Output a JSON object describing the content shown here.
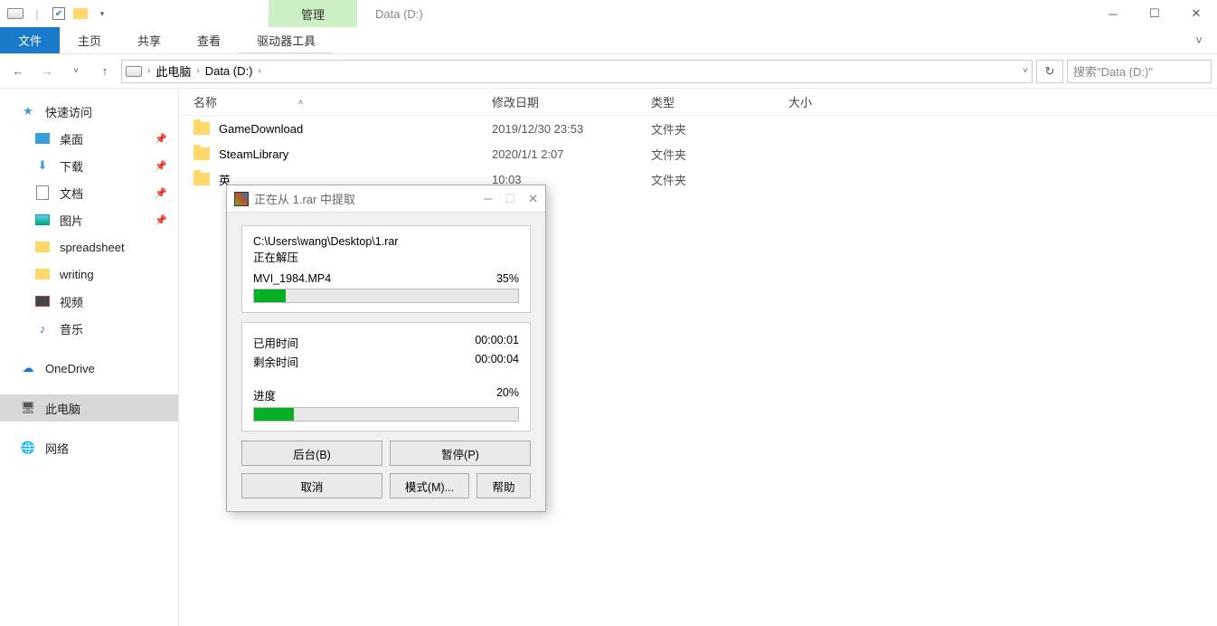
{
  "titlebar": {
    "manage_tab": "管理",
    "window_title": "Data (D:)"
  },
  "ribbon": {
    "file": "文件",
    "home": "主页",
    "share": "共享",
    "view": "查看",
    "drive_tools": "驱动器工具"
  },
  "breadcrumb": {
    "root": "此电脑",
    "current": "Data (D:)"
  },
  "search": {
    "placeholder": "搜索\"Data (D:)\""
  },
  "sidebar": {
    "quick": "快速访问",
    "desktop": "桌面",
    "downloads": "下载",
    "documents": "文档",
    "pictures": "图片",
    "spreadsheet": "spreadsheet",
    "writing": "writing",
    "videos": "视频",
    "music": "音乐",
    "onedrive": "OneDrive",
    "thispc": "此电脑",
    "network": "网络"
  },
  "columns": {
    "name": "名称",
    "date": "修改日期",
    "type": "类型",
    "size": "大小"
  },
  "rows": [
    {
      "name": "GameDownload",
      "date": "2019/12/30 23:53",
      "type": "文件夹"
    },
    {
      "name": "SteamLibrary",
      "date": "2020/1/1 2:07",
      "type": "文件夹"
    },
    {
      "name": "英",
      "date": "10:03",
      "type": "文件夹"
    }
  ],
  "dialog": {
    "title": "正在从 1.rar 中提取",
    "path": "C:\\Users\\wang\\Desktop\\1.rar",
    "extracting": "正在解压",
    "file": "MVI_1984.MP4",
    "file_pct": "35%",
    "file_pct_num": 35,
    "elapsed_label": "已用时间",
    "elapsed": "00:00:01",
    "remain_label": "剩余时间",
    "remain": "00:00:04",
    "progress_label": "进度",
    "progress_pct": "20%",
    "progress_pct_num": 20,
    "btn_bg": "后台(B)",
    "btn_pause": "暂停(P)",
    "btn_cancel": "取消",
    "btn_mode": "模式(M)...",
    "btn_help": "帮助"
  }
}
